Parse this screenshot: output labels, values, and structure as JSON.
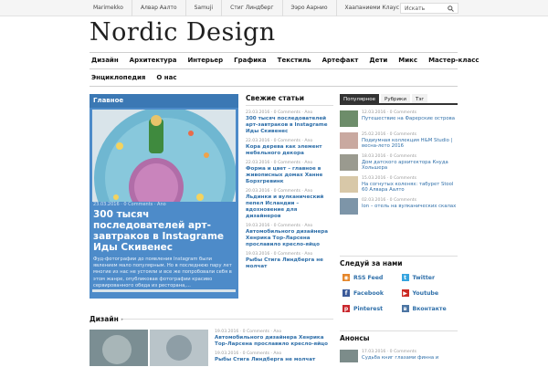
{
  "topbar": {
    "links": [
      "Marimekko",
      "Алвар Аалто",
      "Samuji",
      "Стиг Линдберг",
      "Ээро Аарнио",
      "Хаапаниеми Клаус"
    ],
    "search_placeholder": "Искать"
  },
  "logo": "Nordic Design",
  "nav": {
    "row1": [
      "Дизайн",
      "Архитектура",
      "Интерьер",
      "Графика",
      "Текстиль",
      "Артефакт",
      "Дети",
      "Микс",
      "Мастер-класс"
    ],
    "row2": [
      "Энциклопедия",
      "О нас"
    ]
  },
  "featured": {
    "heading": "Главное",
    "meta": "23.03.2016 · 0 Comments · Ano",
    "title": "300 тысяч последователей арт-завтраков в Instagrame Иды Скивенес",
    "desc": "Фуд-фотографии до появления Instagram были явлением мало популярным. Но в последнюю пару лет многие из нас не устояли и все же попробовали себя в этом жанре, опубликовав фотографии красиво сервированного обеда из ресторана,..."
  },
  "fresh": {
    "heading": "Свежие статьи",
    "items": [
      {
        "meta": "23.03.2016 · 0 Comments · Ano",
        "title": "300 тысяч последователей арт-завтраков в Instagrame Иды Скивенес"
      },
      {
        "meta": "22.03.2016 · 0 Comments · Ano",
        "title": "Кора дерева как элемент мебельного декора"
      },
      {
        "meta": "22.03.2016 · 0 Comments · Ano",
        "title": "Форма и цвет – главное в живописных домах Ханне Борхгревинк"
      },
      {
        "meta": "20.03.2016 · 0 Comments · Ano",
        "title": "Льдинки и вулканический пепел Исландии – вдохновение для дизайнеров"
      },
      {
        "meta": "19.03.2016 · 0 Comments · Ano",
        "title": "Автомобильного дизайнера Хенрика Тор-Ларсена прославило кресло-яйцо"
      },
      {
        "meta": "19.03.2016 · 0 Comments · Ano",
        "title": "Рыбы Стига Линдберга не молчат"
      }
    ]
  },
  "tabs": [
    "Популярное",
    "Рубрики",
    "Тэг"
  ],
  "popular": [
    {
      "meta": "12.03.2016 · 0 Comments",
      "title": "Путешествие на Фарерские острова",
      "color": "#6d8d6a"
    },
    {
      "meta": "25.02.2016 · 0 Comments",
      "title": "Подиумная коллекция H&M Studio | весна-лето 2016",
      "color": "#c9a9a0"
    },
    {
      "meta": "18.03.2016 · 0 Comments",
      "title": "Дом датского архитектора Кнуда Хольшера",
      "color": "#9a9a8f"
    },
    {
      "meta": "15.03.2016 · 0 Comments",
      "title": "На согнутых коленях: табурет Stool 60 Алвара Аалто",
      "color": "#d8c8a8"
    },
    {
      "meta": "02.03.2016 · 0 Comments",
      "title": "Ion – отель на вулканических скалах",
      "color": "#7d95a8"
    }
  ],
  "follow": {
    "heading": "Следуй за нами",
    "items": [
      {
        "label": "RSS Feed",
        "icon": "rss-icon",
        "color": "#e5862a"
      },
      {
        "label": "Twitter",
        "icon": "twitter-icon",
        "color": "#36a4df"
      },
      {
        "label": "Facebook",
        "icon": "facebook-icon",
        "color": "#3b5a99"
      },
      {
        "label": "Youtube",
        "icon": "youtube-icon",
        "color": "#cc2b25"
      },
      {
        "label": "Pinterest",
        "icon": "pinterest-icon",
        "color": "#c9272d"
      },
      {
        "label": "Вконтакте",
        "icon": "vk-icon",
        "color": "#4c75a3"
      }
    ]
  },
  "anons": {
    "heading": "Анонсы",
    "item": {
      "meta": "17.03.2016 · 0 Comments",
      "title": "Судьба книг глазами финна и"
    }
  },
  "design": {
    "heading": "Дизайн",
    "items": [
      {
        "meta": "19.03.2016 · 0 Comments · Ano",
        "title": "Автомобильного дизайнера Хенрика Тор-Ларсена прославило кресло-яйцо"
      },
      {
        "meta": "19.03.2016 · 0 Comments · Ano",
        "title": "Рыбы Стига Линдберга не молчат"
      }
    ]
  },
  "colors": {
    "accent": "#2f6fa9",
    "featured_bg": "#4d8bc9"
  }
}
